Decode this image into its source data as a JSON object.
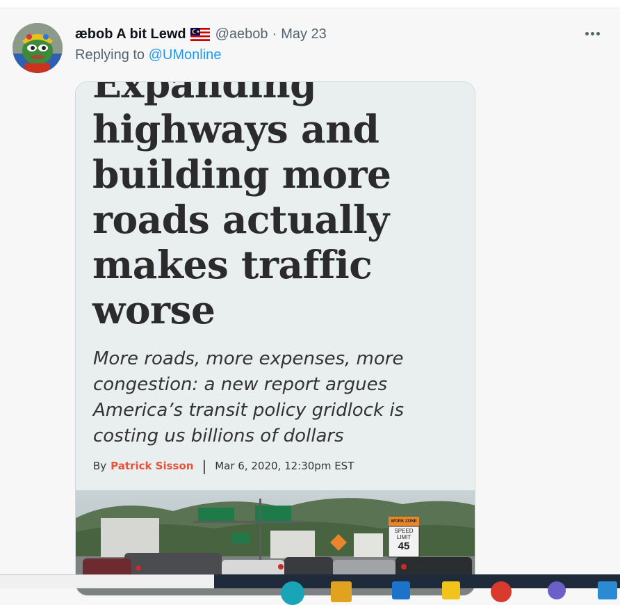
{
  "tweet": {
    "display_name": "æbob A bit Lewd",
    "handle": "@aebob",
    "separator": "·",
    "date": "May 23",
    "reply_prefix": "Replying to",
    "reply_mention": "@UMonline"
  },
  "media": {
    "headline": "Expanding highways and building more roads actually makes traffic worse",
    "dek": "More roads, more expenses, more congestion: a new report argues America’s transit policy gridlock is costing us billions of dollars",
    "byline_prefix": "By",
    "author": "Patrick Sisson",
    "byline_separator": "|",
    "timestamp": "Mar 6, 2020, 12:30pm EST"
  },
  "photo_signs": {
    "speed_sign_line1": "SPEED",
    "speed_sign_line2": "LIMIT",
    "speed_sign_value": "45",
    "work_zone": "WORK ZONE"
  },
  "icons": {
    "more": "more-horizontal-icon",
    "flag": "malaysia-flag-icon"
  },
  "colors": {
    "link": "#1d9bf0",
    "secondary_text": "#536471",
    "author_accent": "#e5533d",
    "card_bg": "#e9efee"
  }
}
